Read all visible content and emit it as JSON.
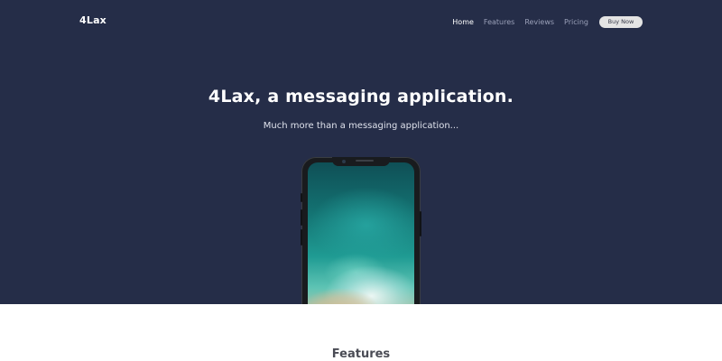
{
  "brand": {
    "logo": "4Lax"
  },
  "nav": {
    "items": [
      {
        "label": "Home",
        "active": true
      },
      {
        "label": "Features",
        "active": false
      },
      {
        "label": "Reviews",
        "active": false
      },
      {
        "label": "Pricing",
        "active": false
      }
    ],
    "cta_label": "Buy Now"
  },
  "hero": {
    "title": "4Lax, a messaging application.",
    "subtitle": "Much more than a messaging application...",
    "image": "phone-mockup-ocean-wallpaper"
  },
  "features": {
    "heading": "Features"
  },
  "colors": {
    "hero_background": "#252d48",
    "nav_inactive": "#9aa0b8",
    "nav_active": "#ffffff",
    "cta_background": "#e4e4e4",
    "page_background": "#ffffff"
  }
}
